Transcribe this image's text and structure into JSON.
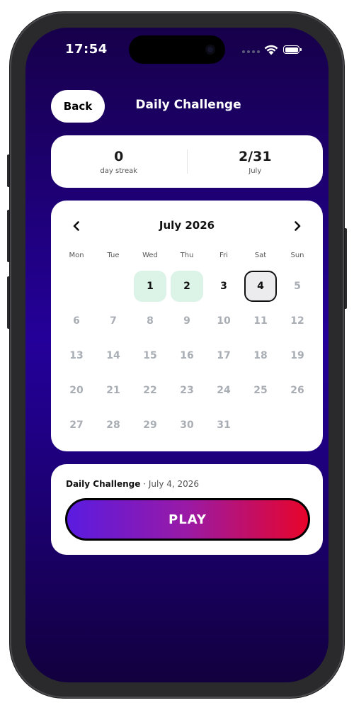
{
  "status_bar": {
    "time": "17:54"
  },
  "header": {
    "back_label": "Back",
    "title": "Daily Challenge"
  },
  "stats": {
    "streak_value": "0",
    "streak_label": "day streak",
    "progress_value": "2/31",
    "progress_label": "July"
  },
  "calendar": {
    "month_label": "July 2026",
    "prev_icon": "chevron-left-icon",
    "next_icon": "chevron-right-icon",
    "weekdays": [
      "Mon",
      "Tue",
      "Wed",
      "Thu",
      "Fri",
      "Sat",
      "Sun"
    ],
    "days": [
      {
        "label": "",
        "state": "empty"
      },
      {
        "label": "",
        "state": "empty"
      },
      {
        "label": "1",
        "state": "completed"
      },
      {
        "label": "2",
        "state": "completed"
      },
      {
        "label": "3",
        "state": "available"
      },
      {
        "label": "4",
        "state": "selected"
      },
      {
        "label": "5",
        "state": "locked"
      },
      {
        "label": "6",
        "state": "locked"
      },
      {
        "label": "7",
        "state": "locked"
      },
      {
        "label": "8",
        "state": "locked"
      },
      {
        "label": "9",
        "state": "locked"
      },
      {
        "label": "10",
        "state": "locked"
      },
      {
        "label": "11",
        "state": "locked"
      },
      {
        "label": "12",
        "state": "locked"
      },
      {
        "label": "13",
        "state": "locked"
      },
      {
        "label": "14",
        "state": "locked"
      },
      {
        "label": "15",
        "state": "locked"
      },
      {
        "label": "16",
        "state": "locked"
      },
      {
        "label": "17",
        "state": "locked"
      },
      {
        "label": "18",
        "state": "locked"
      },
      {
        "label": "19",
        "state": "locked"
      },
      {
        "label": "20",
        "state": "locked"
      },
      {
        "label": "21",
        "state": "locked"
      },
      {
        "label": "22",
        "state": "locked"
      },
      {
        "label": "23",
        "state": "locked"
      },
      {
        "label": "24",
        "state": "locked"
      },
      {
        "label": "25",
        "state": "locked"
      },
      {
        "label": "26",
        "state": "locked"
      },
      {
        "label": "27",
        "state": "locked"
      },
      {
        "label": "28",
        "state": "locked"
      },
      {
        "label": "29",
        "state": "locked"
      },
      {
        "label": "30",
        "state": "locked"
      },
      {
        "label": "31",
        "state": "locked"
      }
    ]
  },
  "play_card": {
    "challenge_name": "Daily Challenge",
    "separator": "·",
    "date": "July 4, 2026",
    "play_label": "PLAY"
  },
  "colors": {
    "background_top": "#17004a",
    "background_mid": "#24009a",
    "completed_day": "#dcf3e8",
    "selected_day": "#ececef",
    "locked_day_text": "#a9aeb5",
    "play_gradient_start": "#5a1be0",
    "play_gradient_end": "#e8042a"
  }
}
